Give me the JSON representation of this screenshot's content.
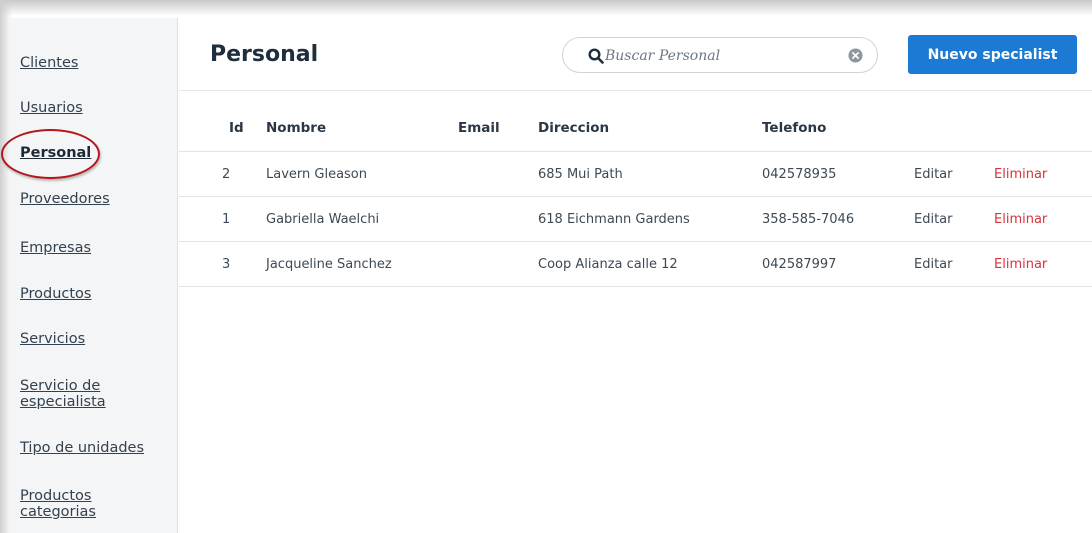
{
  "sidebar": {
    "items": [
      {
        "label": "Clientes",
        "active": false
      },
      {
        "label": "Usuarios",
        "active": false
      },
      {
        "label": "Personal",
        "active": true
      },
      {
        "label": "Proveedores",
        "active": false
      },
      {
        "label": "Empresas",
        "active": false
      },
      {
        "label": "Productos",
        "active": false
      },
      {
        "label": "Servicios",
        "active": false
      },
      {
        "label": "Servicio de especialista",
        "active": false
      },
      {
        "label": "Tipo de unidades",
        "active": false
      },
      {
        "label": "Productos categorias",
        "active": false
      }
    ]
  },
  "header": {
    "title": "Personal",
    "search_placeholder": "Buscar Personal",
    "search_value": "",
    "new_button_label": "Nuevo specialist"
  },
  "table": {
    "columns": [
      "Id",
      "Nombre",
      "Email",
      "Direccion",
      "Telefono"
    ],
    "rows": [
      {
        "id": "2",
        "nombre": "Lavern Gleason",
        "email": "",
        "direccion": "685 Mui Path",
        "telefono": "042578935",
        "edit": "Editar",
        "delete": "Eliminar"
      },
      {
        "id": "1",
        "nombre": "Gabriella Waelchi",
        "email": "",
        "direccion": "618 Eichmann Gardens",
        "telefono": "358-585-7046",
        "edit": "Editar",
        "delete": "Eliminar"
      },
      {
        "id": "3",
        "nombre": "Jacqueline Sanchez",
        "email": "",
        "direccion": "Coop Alianza calle 12",
        "telefono": "042587997",
        "edit": "Editar",
        "delete": "Eliminar"
      }
    ]
  },
  "colors": {
    "accent": "#1c79d4",
    "danger": "#d8333b",
    "highlight_ring": "#b3171c",
    "sidebar_bg": "#f4f5f6"
  },
  "icons": {
    "search": "search-icon",
    "clear": "clear-icon"
  }
}
